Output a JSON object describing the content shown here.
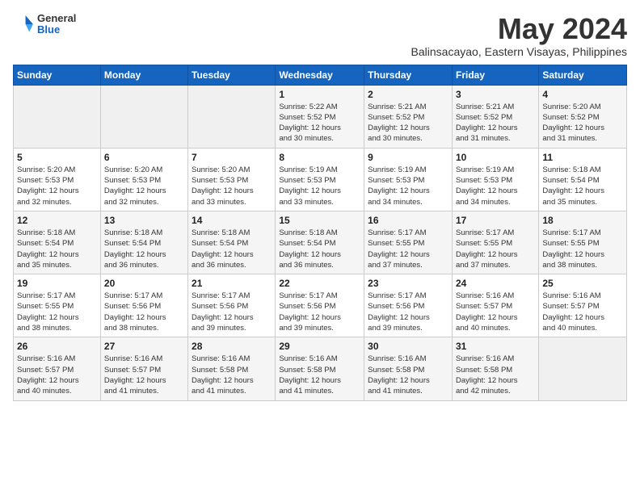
{
  "header": {
    "logo": {
      "general": "General",
      "blue": "Blue"
    },
    "title": "May 2024",
    "subtitle": "Balinsacayao, Eastern Visayas, Philippines"
  },
  "days_of_week": [
    "Sunday",
    "Monday",
    "Tuesday",
    "Wednesday",
    "Thursday",
    "Friday",
    "Saturday"
  ],
  "weeks": [
    {
      "days": [
        {
          "number": "",
          "info": ""
        },
        {
          "number": "",
          "info": ""
        },
        {
          "number": "",
          "info": ""
        },
        {
          "number": "1",
          "info": "Sunrise: 5:22 AM\nSunset: 5:52 PM\nDaylight: 12 hours\nand 30 minutes."
        },
        {
          "number": "2",
          "info": "Sunrise: 5:21 AM\nSunset: 5:52 PM\nDaylight: 12 hours\nand 30 minutes."
        },
        {
          "number": "3",
          "info": "Sunrise: 5:21 AM\nSunset: 5:52 PM\nDaylight: 12 hours\nand 31 minutes."
        },
        {
          "number": "4",
          "info": "Sunrise: 5:20 AM\nSunset: 5:52 PM\nDaylight: 12 hours\nand 31 minutes."
        }
      ]
    },
    {
      "days": [
        {
          "number": "5",
          "info": "Sunrise: 5:20 AM\nSunset: 5:53 PM\nDaylight: 12 hours\nand 32 minutes."
        },
        {
          "number": "6",
          "info": "Sunrise: 5:20 AM\nSunset: 5:53 PM\nDaylight: 12 hours\nand 32 minutes."
        },
        {
          "number": "7",
          "info": "Sunrise: 5:20 AM\nSunset: 5:53 PM\nDaylight: 12 hours\nand 33 minutes."
        },
        {
          "number": "8",
          "info": "Sunrise: 5:19 AM\nSunset: 5:53 PM\nDaylight: 12 hours\nand 33 minutes."
        },
        {
          "number": "9",
          "info": "Sunrise: 5:19 AM\nSunset: 5:53 PM\nDaylight: 12 hours\nand 34 minutes."
        },
        {
          "number": "10",
          "info": "Sunrise: 5:19 AM\nSunset: 5:53 PM\nDaylight: 12 hours\nand 34 minutes."
        },
        {
          "number": "11",
          "info": "Sunrise: 5:18 AM\nSunset: 5:54 PM\nDaylight: 12 hours\nand 35 minutes."
        }
      ]
    },
    {
      "days": [
        {
          "number": "12",
          "info": "Sunrise: 5:18 AM\nSunset: 5:54 PM\nDaylight: 12 hours\nand 35 minutes."
        },
        {
          "number": "13",
          "info": "Sunrise: 5:18 AM\nSunset: 5:54 PM\nDaylight: 12 hours\nand 36 minutes."
        },
        {
          "number": "14",
          "info": "Sunrise: 5:18 AM\nSunset: 5:54 PM\nDaylight: 12 hours\nand 36 minutes."
        },
        {
          "number": "15",
          "info": "Sunrise: 5:18 AM\nSunset: 5:54 PM\nDaylight: 12 hours\nand 36 minutes."
        },
        {
          "number": "16",
          "info": "Sunrise: 5:17 AM\nSunset: 5:55 PM\nDaylight: 12 hours\nand 37 minutes."
        },
        {
          "number": "17",
          "info": "Sunrise: 5:17 AM\nSunset: 5:55 PM\nDaylight: 12 hours\nand 37 minutes."
        },
        {
          "number": "18",
          "info": "Sunrise: 5:17 AM\nSunset: 5:55 PM\nDaylight: 12 hours\nand 38 minutes."
        }
      ]
    },
    {
      "days": [
        {
          "number": "19",
          "info": "Sunrise: 5:17 AM\nSunset: 5:55 PM\nDaylight: 12 hours\nand 38 minutes."
        },
        {
          "number": "20",
          "info": "Sunrise: 5:17 AM\nSunset: 5:56 PM\nDaylight: 12 hours\nand 38 minutes."
        },
        {
          "number": "21",
          "info": "Sunrise: 5:17 AM\nSunset: 5:56 PM\nDaylight: 12 hours\nand 39 minutes."
        },
        {
          "number": "22",
          "info": "Sunrise: 5:17 AM\nSunset: 5:56 PM\nDaylight: 12 hours\nand 39 minutes."
        },
        {
          "number": "23",
          "info": "Sunrise: 5:17 AM\nSunset: 5:56 PM\nDaylight: 12 hours\nand 39 minutes."
        },
        {
          "number": "24",
          "info": "Sunrise: 5:16 AM\nSunset: 5:57 PM\nDaylight: 12 hours\nand 40 minutes."
        },
        {
          "number": "25",
          "info": "Sunrise: 5:16 AM\nSunset: 5:57 PM\nDaylight: 12 hours\nand 40 minutes."
        }
      ]
    },
    {
      "days": [
        {
          "number": "26",
          "info": "Sunrise: 5:16 AM\nSunset: 5:57 PM\nDaylight: 12 hours\nand 40 minutes."
        },
        {
          "number": "27",
          "info": "Sunrise: 5:16 AM\nSunset: 5:57 PM\nDaylight: 12 hours\nand 41 minutes."
        },
        {
          "number": "28",
          "info": "Sunrise: 5:16 AM\nSunset: 5:58 PM\nDaylight: 12 hours\nand 41 minutes."
        },
        {
          "number": "29",
          "info": "Sunrise: 5:16 AM\nSunset: 5:58 PM\nDaylight: 12 hours\nand 41 minutes."
        },
        {
          "number": "30",
          "info": "Sunrise: 5:16 AM\nSunset: 5:58 PM\nDaylight: 12 hours\nand 41 minutes."
        },
        {
          "number": "31",
          "info": "Sunrise: 5:16 AM\nSunset: 5:58 PM\nDaylight: 12 hours\nand 42 minutes."
        },
        {
          "number": "",
          "info": ""
        }
      ]
    }
  ]
}
